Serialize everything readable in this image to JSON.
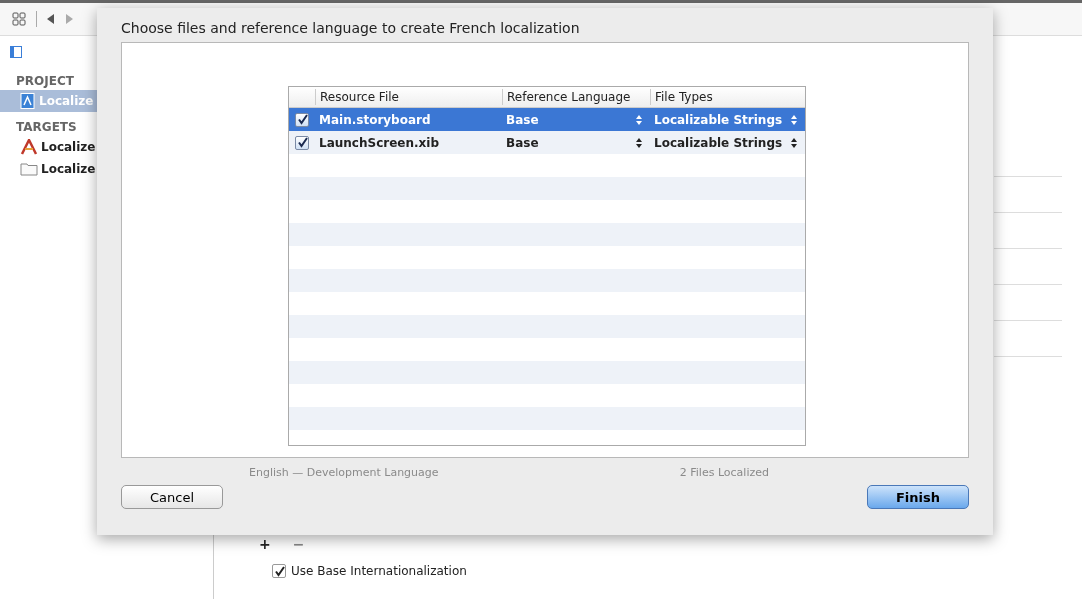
{
  "sidebar": {
    "sections": [
      {
        "title": "PROJECT",
        "items": [
          {
            "label": "Localize",
            "kind": "project",
            "selected": true
          }
        ]
      },
      {
        "title": "TARGETS",
        "items": [
          {
            "label": "Localize",
            "kind": "app",
            "selected": false
          },
          {
            "label": "Localize",
            "kind": "tests",
            "selected": false
          }
        ]
      }
    ]
  },
  "background": {
    "add": "+",
    "remove": "−",
    "base_internationalization": {
      "label": "Use Base Internationalization",
      "checked": true
    }
  },
  "dialog": {
    "title": "Choose files and reference language to create French localization",
    "columns": [
      "Resource File",
      "Reference Language",
      "File Types"
    ],
    "rows": [
      {
        "file": "Main.storyboard",
        "checked": true,
        "language": "Base",
        "types": "Localizable Strings",
        "selected": true
      },
      {
        "file": "LaunchScreen.xib",
        "checked": true,
        "language": "Base",
        "types": "Localizable Strings",
        "selected": false
      }
    ],
    "behind": [
      "English — Development Language",
      "2 Files Localized"
    ],
    "buttons": [
      {
        "label": "Cancel",
        "kind": "normal"
      },
      {
        "label": "Finish",
        "kind": "default"
      }
    ]
  }
}
